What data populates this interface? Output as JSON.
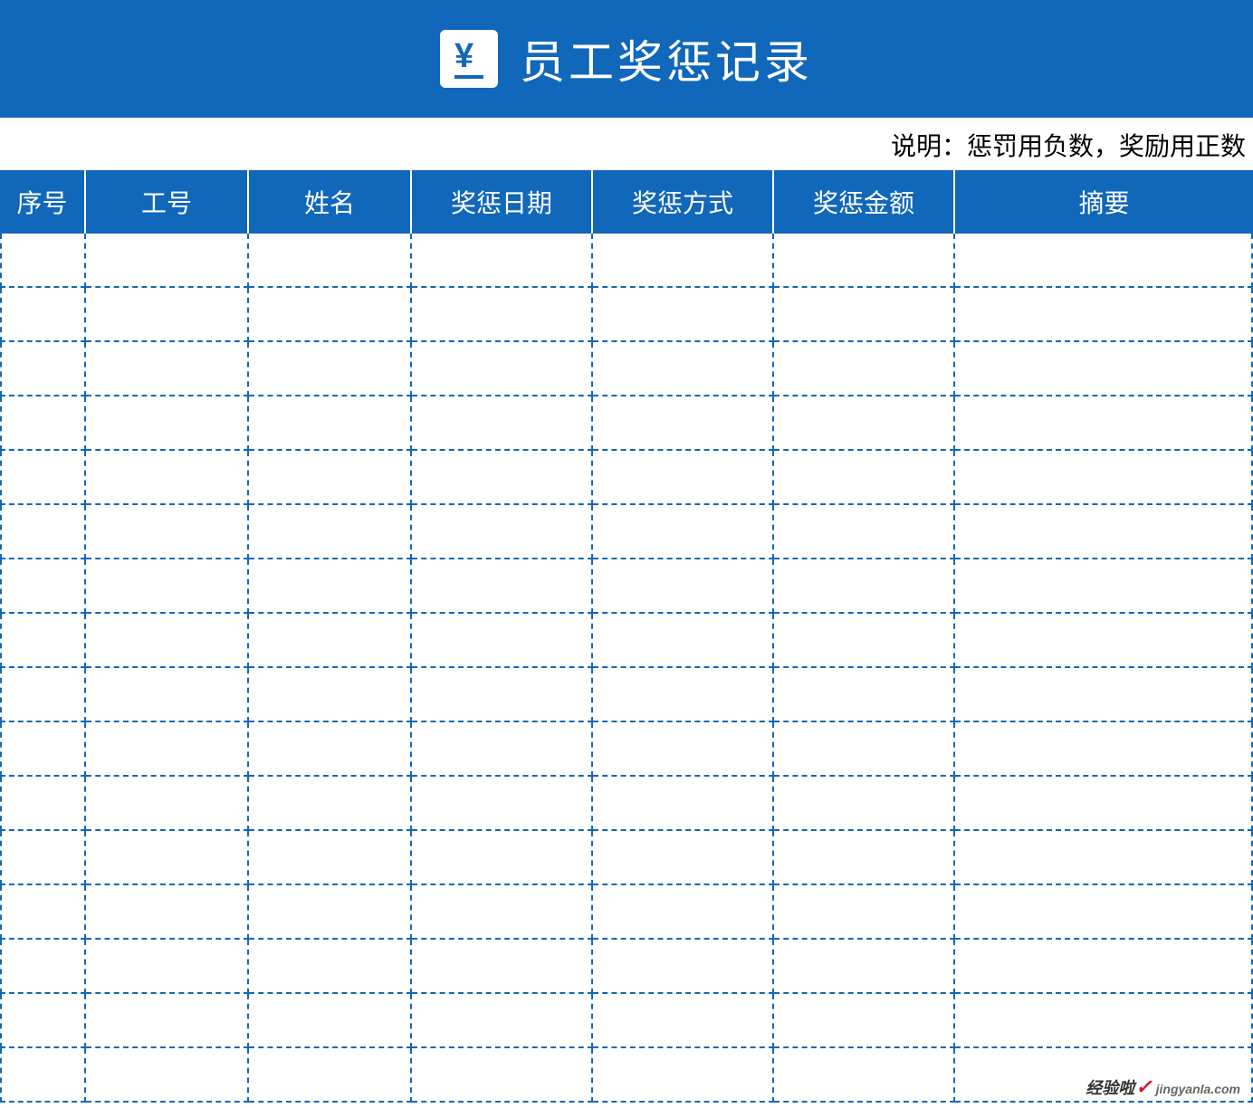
{
  "header": {
    "title": "员工奖惩记录",
    "icon_symbol": "¥"
  },
  "note": "说明：惩罚用负数，奖励用正数",
  "table": {
    "columns": [
      "序号",
      "工号",
      "姓名",
      "奖惩日期",
      "奖惩方式",
      "奖惩金额",
      "摘要"
    ],
    "rows": [
      {
        "seq": "",
        "emp_no": "",
        "name": "",
        "date": "",
        "type": "",
        "amount": "",
        "summary": ""
      },
      {
        "seq": "",
        "emp_no": "",
        "name": "",
        "date": "",
        "type": "",
        "amount": "",
        "summary": ""
      },
      {
        "seq": "",
        "emp_no": "",
        "name": "",
        "date": "",
        "type": "",
        "amount": "",
        "summary": ""
      },
      {
        "seq": "",
        "emp_no": "",
        "name": "",
        "date": "",
        "type": "",
        "amount": "",
        "summary": ""
      },
      {
        "seq": "",
        "emp_no": "",
        "name": "",
        "date": "",
        "type": "",
        "amount": "",
        "summary": ""
      },
      {
        "seq": "",
        "emp_no": "",
        "name": "",
        "date": "",
        "type": "",
        "amount": "",
        "summary": ""
      },
      {
        "seq": "",
        "emp_no": "",
        "name": "",
        "date": "",
        "type": "",
        "amount": "",
        "summary": ""
      },
      {
        "seq": "",
        "emp_no": "",
        "name": "",
        "date": "",
        "type": "",
        "amount": "",
        "summary": ""
      },
      {
        "seq": "",
        "emp_no": "",
        "name": "",
        "date": "",
        "type": "",
        "amount": "",
        "summary": ""
      },
      {
        "seq": "",
        "emp_no": "",
        "name": "",
        "date": "",
        "type": "",
        "amount": "",
        "summary": ""
      },
      {
        "seq": "",
        "emp_no": "",
        "name": "",
        "date": "",
        "type": "",
        "amount": "",
        "summary": ""
      },
      {
        "seq": "",
        "emp_no": "",
        "name": "",
        "date": "",
        "type": "",
        "amount": "",
        "summary": ""
      },
      {
        "seq": "",
        "emp_no": "",
        "name": "",
        "date": "",
        "type": "",
        "amount": "",
        "summary": ""
      },
      {
        "seq": "",
        "emp_no": "",
        "name": "",
        "date": "",
        "type": "",
        "amount": "",
        "summary": ""
      },
      {
        "seq": "",
        "emp_no": "",
        "name": "",
        "date": "",
        "type": "",
        "amount": "",
        "summary": ""
      },
      {
        "seq": "",
        "emp_no": "",
        "name": "",
        "date": "",
        "type": "",
        "amount": "",
        "summary": ""
      }
    ]
  },
  "watermark": {
    "main": "经验啦",
    "check": "✓",
    "domain": "jingyanla.com"
  }
}
